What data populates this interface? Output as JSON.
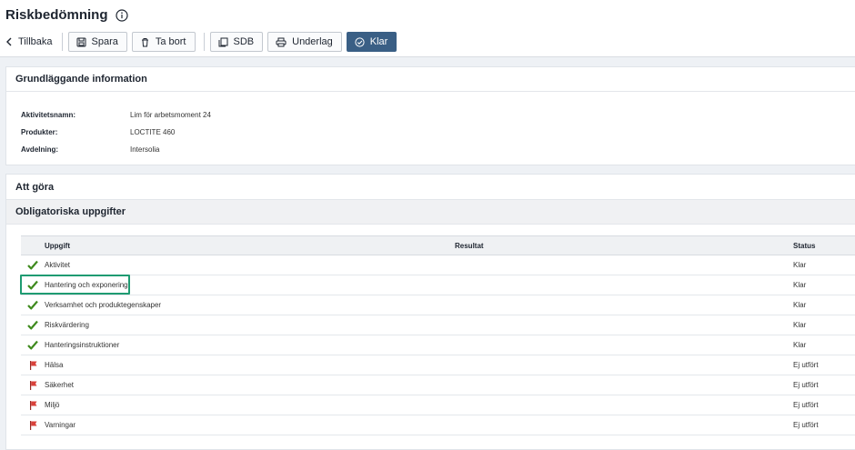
{
  "page": {
    "title": "Riskbedömning",
    "info_icon": "info-circle-icon"
  },
  "toolbar": {
    "back_label": "Tillbaka",
    "save_label": "Spara",
    "delete_label": "Ta bort",
    "sdb_label": "SDB",
    "basis_label": "Underlag",
    "done_label": "Klar"
  },
  "basic_info": {
    "heading": "Grundläggande information",
    "rows": [
      {
        "key": "Aktivitetsnamn:",
        "value": "Lim för arbetsmoment 24"
      },
      {
        "key": "Produkter:",
        "value": "LOCTITE 460"
      },
      {
        "key": "Avdelning:",
        "value": "Intersolia"
      }
    ]
  },
  "todo": {
    "heading": "Att göra",
    "subheading": "Obligatoriska uppgifter",
    "columns": {
      "task": "Uppgift",
      "result": "Resultat",
      "status": "Status"
    },
    "rows": [
      {
        "icon": "check-icon",
        "task": "Aktivitet",
        "result": "",
        "status": "Klar"
      },
      {
        "icon": "check-icon",
        "task": "Hantering och exponering",
        "result": "",
        "status": "Klar"
      },
      {
        "icon": "check-icon",
        "task": "Verksamhet och produktegenskaper",
        "result": "",
        "status": "Klar"
      },
      {
        "icon": "check-icon",
        "task": "Riskvärdering",
        "result": "",
        "status": "Klar"
      },
      {
        "icon": "check-icon",
        "task": "Hanteringsinstruktioner",
        "result": "",
        "status": "Klar"
      },
      {
        "icon": "flag-icon",
        "task": "Hälsa",
        "result": "",
        "status": "Ej utfört"
      },
      {
        "icon": "flag-icon",
        "task": "Säkerhet",
        "result": "",
        "status": "Ej utfört"
      },
      {
        "icon": "flag-icon",
        "task": "Miljö",
        "result": "",
        "status": "Ej utfört"
      },
      {
        "icon": "flag-icon",
        "task": "Varningar",
        "result": "",
        "status": "Ej utfört"
      }
    ]
  },
  "colors": {
    "primary": "#3a5f85",
    "check": "#3f8a1e",
    "flag": "#d9413a",
    "highlight": "#1f9b72"
  }
}
